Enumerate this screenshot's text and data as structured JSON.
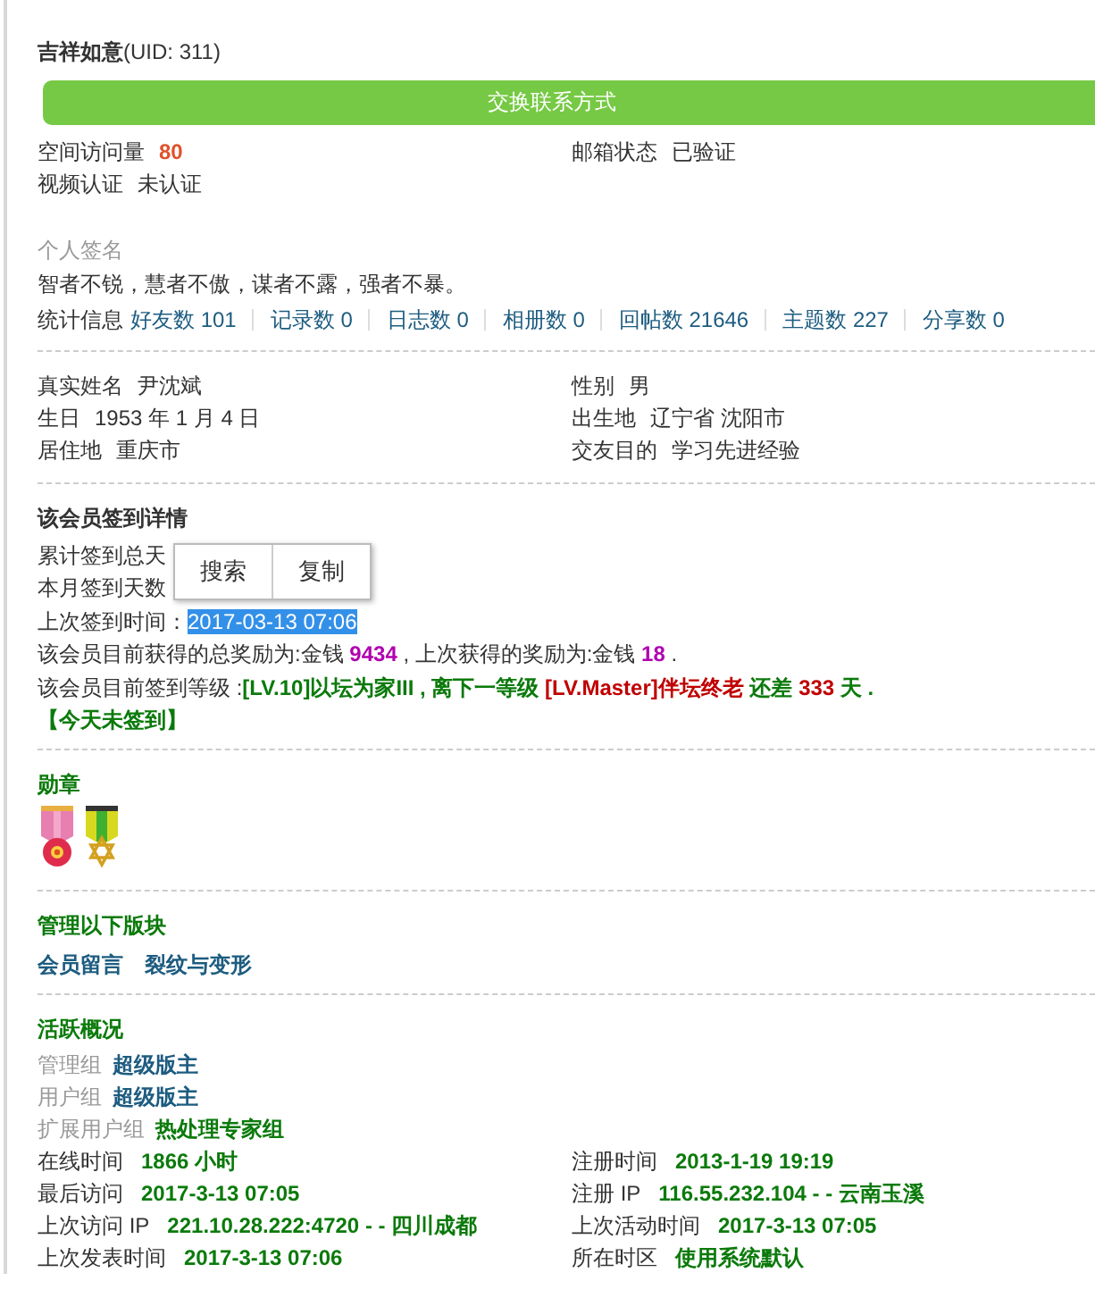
{
  "profile": {
    "name": "吉祥如意",
    "uid": "(UID: 311)",
    "contact_button": "交换联系方式"
  },
  "space_stats": [
    {
      "label": "空间访问量",
      "value": "80",
      "kind": "count"
    },
    {
      "label": "邮箱状态",
      "value": "已验证",
      "kind": "plain"
    },
    {
      "label": "视频认证",
      "value": "未认证",
      "kind": "plain"
    }
  ],
  "signature": {
    "heading": "个人签名",
    "text": "智者不锐，慧者不傲，谋者不露，强者不暴。"
  },
  "statistics": {
    "label": "统计信息",
    "items": [
      "好友数 101",
      "记录数 0",
      "日志数 0",
      "相册数 0",
      "回帖数 21646",
      "主题数 227",
      "分享数 0"
    ]
  },
  "personal": [
    {
      "label": "真实姓名",
      "value": "尹沈斌"
    },
    {
      "label": "性别",
      "value": "男"
    },
    {
      "label": "生日",
      "value": "1953 年 1 月 4 日"
    },
    {
      "label": "出生地",
      "value": "辽宁省 沈阳市"
    },
    {
      "label": "居住地",
      "value": "重庆市"
    },
    {
      "label": "交友目的",
      "value": "学习先进经验"
    }
  ],
  "checkin": {
    "heading": "该会员签到详情",
    "lines": [
      [
        {
          "text": "累计签到总天",
          "kind": "plain"
        }
      ],
      [
        {
          "text": "本月签到天数",
          "kind": "plain"
        }
      ],
      [
        {
          "text": "上次签到时间：",
          "kind": "plain"
        },
        {
          "text": "2017-03-13 07:06",
          "kind": "selection"
        }
      ],
      [
        {
          "text": "该会员目前获得的总奖励为:金钱 ",
          "kind": "plain"
        },
        {
          "text": "9434",
          "kind": "purple"
        },
        {
          "text": " , 上次获得的奖励为:金钱 ",
          "kind": "plain"
        },
        {
          "text": "18",
          "kind": "purple"
        },
        {
          "text": " .",
          "kind": "plain"
        }
      ],
      [
        {
          "text": "该会员目前签到等级 :",
          "kind": "plain"
        },
        {
          "text": "[LV.10]以坛为家III , 离下一等级 ",
          "kind": "green"
        },
        {
          "text": "[LV.Master]伴坛终老",
          "kind": "red"
        },
        {
          "text": " 还差 ",
          "kind": "green"
        },
        {
          "text": "333",
          "kind": "red"
        },
        {
          "text": " 天 .",
          "kind": "green"
        }
      ],
      [
        {
          "text": "【今天未签到】",
          "kind": "green"
        }
      ]
    ],
    "context_menu": [
      "搜索",
      "复制"
    ]
  },
  "medals": {
    "heading": "勋章",
    "items": [
      {
        "kind": "flower"
      },
      {
        "kind": "star"
      }
    ]
  },
  "managed_boards": {
    "heading": "管理以下版块",
    "items": [
      "会员留言",
      "裂纹与变形"
    ]
  },
  "activity": {
    "heading": "活跃概况",
    "groups": [
      {
        "label": "管理组",
        "value": "超级版主",
        "kind": "link"
      },
      {
        "label": "用户组",
        "value": "超级版主",
        "kind": "link"
      },
      {
        "label": "扩展用户组",
        "value": "热处理专家组",
        "kind": "green"
      }
    ],
    "details": [
      {
        "label": "在线时间",
        "value": "1866 小时"
      },
      {
        "label": "注册时间",
        "value": "2013-1-19 19:19"
      },
      {
        "label": "最后访问",
        "value": "2017-3-13 07:05"
      },
      {
        "label": "注册 IP",
        "value": "116.55.232.104 - - 云南玉溪"
      },
      {
        "label": "上次访问 IP",
        "value": "221.10.28.222:4720 - - 四川成都"
      },
      {
        "label": "上次活动时间",
        "value": "2017-3-13 07:05"
      },
      {
        "label": "上次发表时间",
        "value": "2017-3-13 07:06"
      },
      {
        "label": "所在时区",
        "value": "使用系统默认"
      }
    ]
  }
}
